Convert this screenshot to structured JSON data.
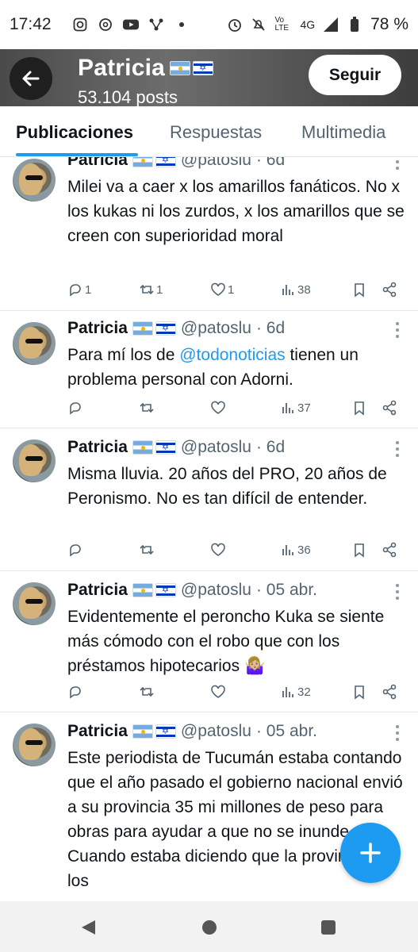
{
  "status_bar": {
    "time": "17:42",
    "network": "4G",
    "battery": "78 %"
  },
  "profile": {
    "name": "Patricia",
    "posts": "53.104 posts",
    "follow_label": "Seguir"
  },
  "tabs": [
    {
      "label": "Publicaciones",
      "active": true
    },
    {
      "label": "Respuestas",
      "active": false
    },
    {
      "label": "Multimedia",
      "active": false
    }
  ],
  "tweets": [
    {
      "name": "Patricia",
      "handle": "@patoslu",
      "time": "· 6d",
      "text": "Milei va a caer x los amarillos fanáticos. No x los kukas ni los zurdos, x los amarillos que se creen con superioridad moral",
      "replies": "1",
      "reposts": "1",
      "likes": "1",
      "views": "38"
    },
    {
      "name": "Patricia",
      "handle": "@patoslu",
      "time": "· 6d",
      "text_pre": "Para mí los de ",
      "mention": "@todonoticias",
      "text_post": " tienen un problema personal con Adorni.",
      "replies": "",
      "reposts": "",
      "likes": "",
      "views": "37"
    },
    {
      "name": "Patricia",
      "handle": "@patoslu",
      "time": "· 6d",
      "text": "Misma lluvia. 20 años del PRO, 20 años de Peronismo. No es tan difícil de entender.",
      "replies": "",
      "reposts": "",
      "likes": "",
      "views": "36"
    },
    {
      "name": "Patricia",
      "handle": "@patoslu",
      "time": "· 05 abr.",
      "text": "Evidentemente el peroncho Kuka se siente más cómodo con el robo que con los préstamos hipotecarios 🤷🏼‍♀️",
      "replies": "",
      "reposts": "",
      "likes": "",
      "views": "32"
    },
    {
      "name": "Patricia",
      "handle": "@patoslu",
      "time": "· 05 abr.",
      "text": "Este periodista de Tucumán estaba contando que el año pasado el gobierno nacional envió a su provincia 35 mi millones de peso para obras para ayudar a que no se inunde. Cuando estaba diciendo que la provincia no los"
    }
  ],
  "colors": {
    "accent": "#1d9bf0",
    "text": "#0f1419",
    "muted": "#536471"
  },
  "icons": [
    "back-arrow-icon",
    "reply-icon",
    "repost-icon",
    "like-icon",
    "views-icon",
    "bookmark-icon",
    "share-icon",
    "compose-plus-icon"
  ]
}
